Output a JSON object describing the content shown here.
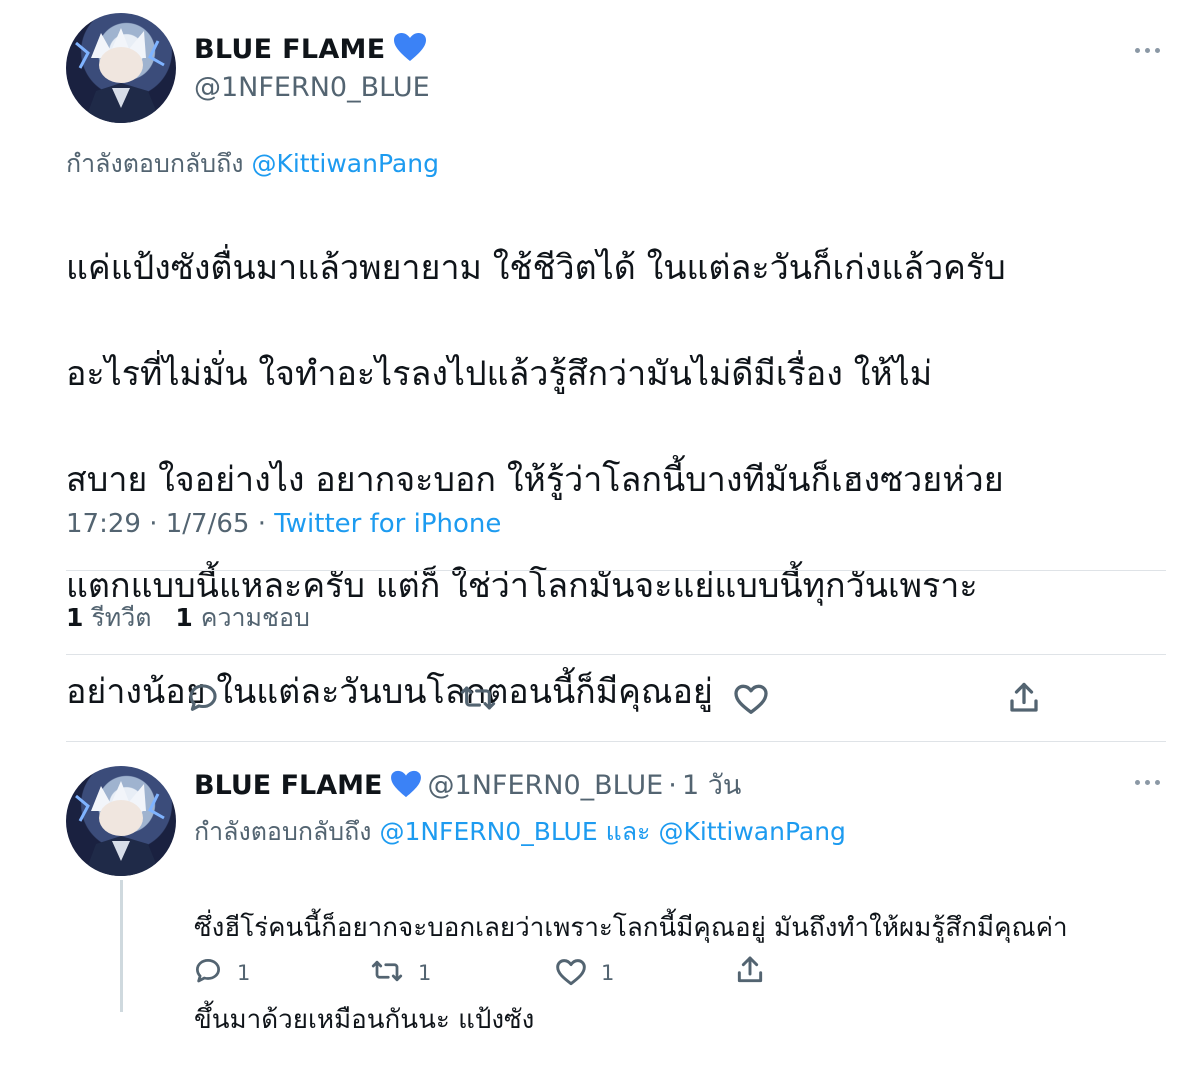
{
  "tweet": {
    "display_name": "BLUE FLAME",
    "handle": "@1NFERN0_BLUE",
    "replying_prefix": "กำลังตอบกลับถึง",
    "replying_to": "@KittiwanPang",
    "text_lines": [
      "แค่แป้งซังตื่นมาแล้วพยายาม ใช้ชีวิตได้ ในแต่ละวันก็เก่งแล้วครับ",
      "อะไรที่ไม่มั่น ใจทำอะไรลงไปแล้วรู้สึกว่ามันไม่ดีมีเรื่อง ให้ไม่",
      "สบาย ใจอย่างไง อยากจะบอก ให้รู้ว่าโลกนี้บางทีมันก็เฮงซวยห่วย",
      "แตกแบบนี้แหละครับ แต่ก็ ใช่ว่าโลกมันจะแย่แบบนี้ทุกวันเพราะ",
      "อย่างน้อย ในแต่ละวันบนโลกตอนนี้ก็มีคุณอยู่"
    ],
    "time": "17:29",
    "date": "1/7/65",
    "source": "Twitter for iPhone",
    "retweet_count": "1",
    "retweet_label": "รีทวีต",
    "like_count": "1",
    "like_label": "ความชอบ",
    "actions": [
      "reply-icon",
      "retweet-icon",
      "like-icon",
      "share-icon"
    ]
  },
  "reply": {
    "display_name": "BLUE FLAME",
    "handle": "@1NFERN0_BLUE",
    "age": "1 วัน",
    "replying_prefix": "กำลังตอบกลับถึง",
    "replying_to_1": "@1NFERN0_BLUE",
    "replying_and": "และ",
    "replying_to_2": "@KittiwanPang",
    "text_lines": [
      "ซึ่งฮีโร่คนนี้ก็อยากจะบอกเลยว่าเพราะโลกนี้มีคุณอยู่ มันถึงทำให้ผมรู้สึกมีคุณค่า",
      "ขึ้นมาด้วยเหมือนกันนะ แป้งซัง"
    ],
    "reply_count": "1",
    "retweet_count": "1",
    "like_count": "1"
  },
  "colors": {
    "accent": "#1d9bf0",
    "heart_badge": "#3b82f6",
    "secondary_text": "#536471"
  }
}
